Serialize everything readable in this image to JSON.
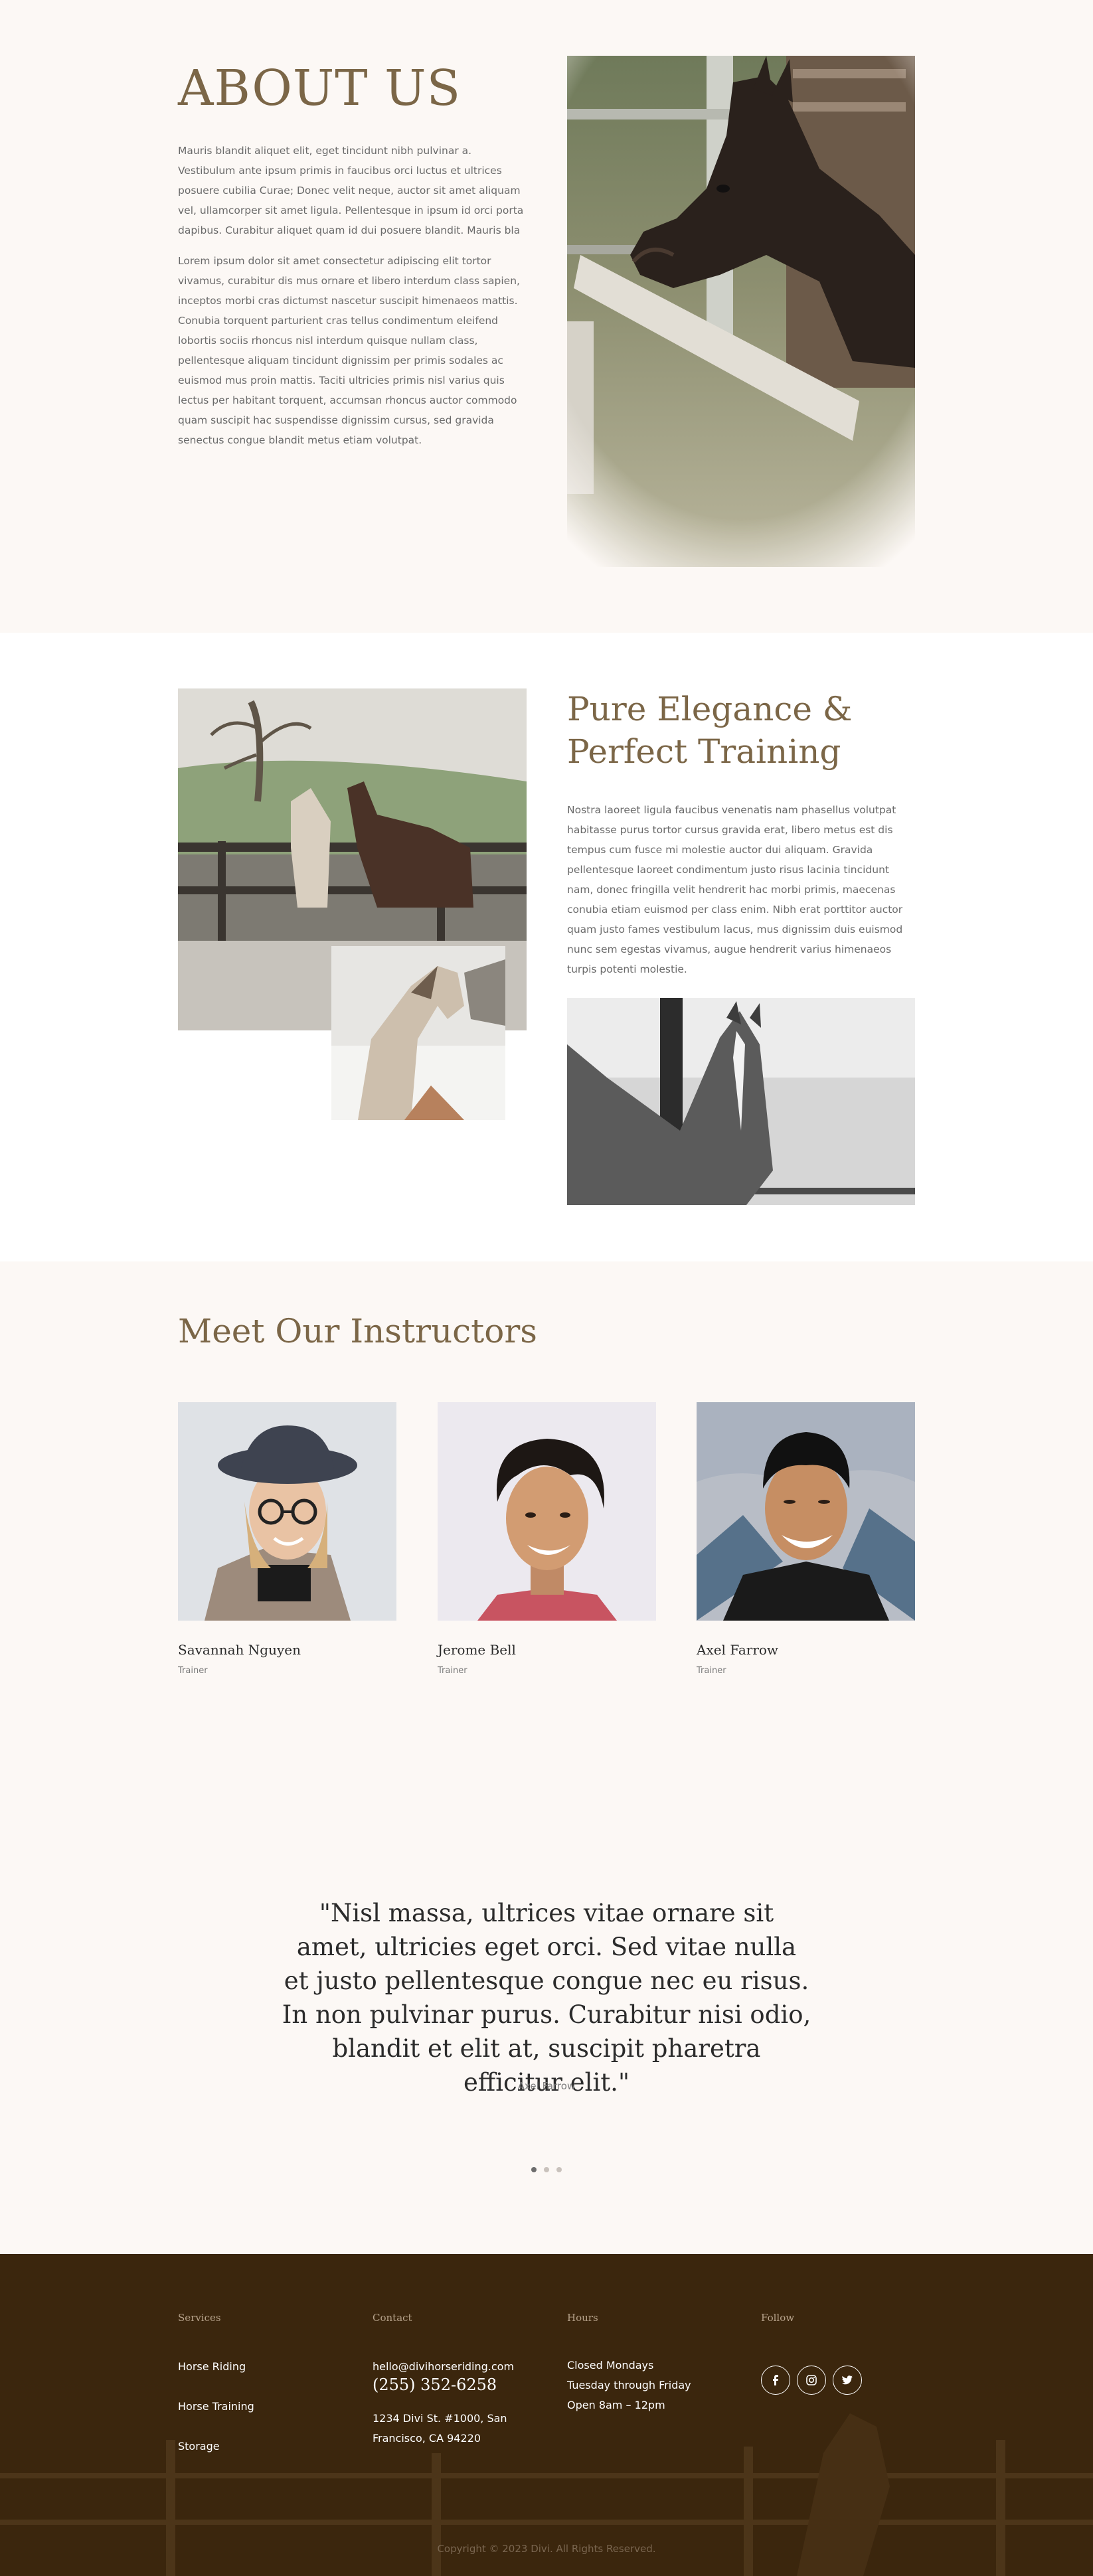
{
  "about": {
    "title": "ABOUT US",
    "para1": "Mauris blandit aliquet elit, eget tincidunt nibh pulvinar a. Vestibulum ante ipsum primis in faucibus orci luctus et ultrices posuere cubilia Curae; Donec velit neque, auctor sit amet aliquam vel, ullamcorper sit amet ligula. Pellentesque in ipsum id orci porta dapibus. Curabitur aliquet quam id dui posuere blandit. Mauris bla",
    "para2": "Lorem ipsum dolor sit amet consectetur adipiscing elit tortor vivamus, curabitur dis mus ornare et libero interdum class sapien, inceptos morbi cras dictumst nascetur suscipit himenaeos mattis. Conubia torquent parturient cras tellus condimentum eleifend lobortis sociis rhoncus nisl interdum quisque nullam class, pellentesque aliquam tincidunt dignissim per primis sodales ac euismod mus proin mattis. Taciti ultricies primis nisl varius quis lectus per habitant torquent, accumsan rhoncus auctor commodo quam suscipit hac suspendisse dignissim cursus, sed gravida senectus congue blandit metus etiam volutpat."
  },
  "elegance": {
    "title": "Pure Elegance & Perfect Training",
    "text": "Nostra laoreet ligula faucibus venenatis nam phasellus volutpat habitasse purus tortor cursus gravida erat, libero metus est dis tempus cum fusce mi molestie auctor dui aliquam. Gravida pellentesque laoreet condimentum justo risus lacinia tincidunt nam, donec fringilla velit hendrerit hac morbi primis, maecenas conubia etiam euismod per class enim. Nibh erat porttitor auctor quam justo fames vestibulum lacus, mus dignissim duis euismod nunc sem egestas vivamus, augue hendrerit varius himenaeos turpis potenti molestie."
  },
  "instructors": {
    "title": "Meet Our Instructors",
    "people": [
      {
        "name": "Savannah Nguyen",
        "role": "Trainer"
      },
      {
        "name": "Jerome Bell",
        "role": "Trainer"
      },
      {
        "name": "Axel Farrow",
        "role": "Trainer"
      }
    ]
  },
  "testimonial": {
    "quote": "\"Nisl massa, ultrices vitae ornare sit amet, ultricies eget orci. Sed vitae nulla et justo pellentesque congue nec eu risus. In non pulvinar purus. Curabitur nisi odio, blandit et elit at, suscipit pharetra efficitur elit.\"",
    "author": "Axel Farrow",
    "slides": 3,
    "active_slide": 1
  },
  "footer": {
    "services_heading": "Services",
    "services": [
      "Horse Riding",
      "Horse Training",
      "Storage"
    ],
    "contact_heading": "Contact",
    "email": "hello@divihorseriding.com",
    "phone": "(255) 352-6258",
    "address_line1": "1234 Divi St. #1000, San",
    "address_line2": "Francisco, CA 94220",
    "hours_heading": "Hours",
    "hours": [
      "Closed Mondays",
      "Tuesday through Friday",
      "Open 8am – 12pm"
    ],
    "follow_heading": "Follow",
    "social": [
      "facebook-icon",
      "instagram-icon",
      "twitter-icon"
    ],
    "copyright": "Copyright © 2023 Divi. All Rights Reserved."
  },
  "colors": {
    "accent": "#7b6647",
    "page_bg": "#fcf8f5",
    "footer_bg": "#3b260d"
  }
}
